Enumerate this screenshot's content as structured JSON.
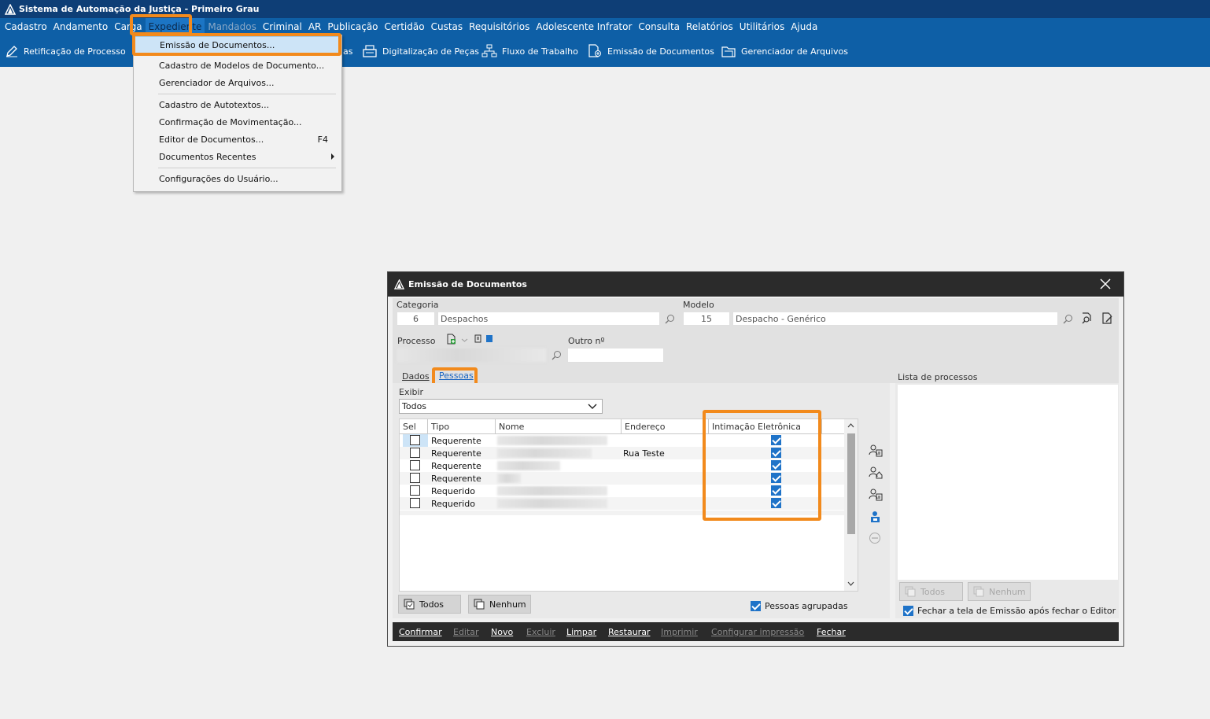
{
  "app": {
    "title": "Sistema de Automação da Justiça - Primeiro Grau"
  },
  "menu": [
    {
      "label": "Cadastro"
    },
    {
      "label": "Andamento"
    },
    {
      "label": "Carga"
    },
    {
      "label": "Expediente"
    },
    {
      "label": "Mandados"
    },
    {
      "label": "Criminal"
    },
    {
      "label": "AR"
    },
    {
      "label": "Publicação"
    },
    {
      "label": "Certidão"
    },
    {
      "label": "Custas"
    },
    {
      "label": "Requisitórios"
    },
    {
      "label": "Adolescente Infrator"
    },
    {
      "label": "Consulta"
    },
    {
      "label": "Relatórios"
    },
    {
      "label": "Utilitários"
    },
    {
      "label": "Ajuda"
    }
  ],
  "toolbar": {
    "retificacao": "Retificação de Processo",
    "partial": "as",
    "digitalizacao": "Digitalização de Peças",
    "fluxo": "Fluxo de Trabalho",
    "emissao": "Emissão de Documentos",
    "gerenciador": "Gerenciador de Arquivos"
  },
  "dropdown": {
    "items": [
      {
        "label": "Emissão de Documentos..."
      },
      {
        "label": "Cadastro de Modelos de Documento..."
      },
      {
        "label": "Gerenciador de Arquivos..."
      },
      {
        "label": "Cadastro de Autotextos..."
      },
      {
        "label": "Confirmação de Movimentação..."
      },
      {
        "label": "Editor de Documentos...",
        "shortcut": "F4"
      },
      {
        "label": "Documentos Recentes"
      },
      {
        "label": "Configurações do Usuário..."
      }
    ]
  },
  "dialog": {
    "title": "Emissão de Documentos",
    "categoria": {
      "label": "Categoria",
      "code": "6",
      "name": "Despachos"
    },
    "modelo": {
      "label": "Modelo",
      "code": "15",
      "name": "Despacho - Genérico"
    },
    "processo": {
      "label": "Processo"
    },
    "outro": {
      "label": "Outro nº",
      "value": ""
    },
    "tabs": {
      "dados": "Dados",
      "pessoas": "Pessoas"
    },
    "exibir": {
      "label": "Exibir",
      "value": "Todos"
    },
    "grid": {
      "headers": {
        "sel": "Sel",
        "tipo": "Tipo",
        "nome": "Nome",
        "endereco": "Endereço",
        "intimacao": "Intimação Eletrônica"
      },
      "rows": [
        {
          "tipo": "Requerente",
          "endereco": "",
          "intimacao": true
        },
        {
          "tipo": "Requerente",
          "endereco": "Rua Teste",
          "intimacao": true
        },
        {
          "tipo": "Requerente",
          "endereco": "",
          "intimacao": true
        },
        {
          "tipo": "Requerente",
          "endereco": "",
          "intimacao": true
        },
        {
          "tipo": "Requerido",
          "endereco": "",
          "intimacao": true
        },
        {
          "tipo": "Requerido",
          "endereco": "",
          "intimacao": true
        }
      ]
    },
    "buttons": {
      "todos": "Todos",
      "nenhum": "Nenhum"
    },
    "pessoas_agrupadas": "Pessoas agrupadas",
    "lista": {
      "label": "Lista de processos",
      "todos": "Todos",
      "nenhum": "Nenhum",
      "fechar_label": "Fechar a tela de Emissão após fechar o Editor"
    },
    "actions": {
      "confirmar": "Confirmar",
      "editar": "Editar",
      "novo": "Novo",
      "excluir": "Excluir",
      "limpar": "Limpar",
      "restaurar": "Restaurar",
      "imprimir": "Imprimir",
      "configurar": "Configurar impressão",
      "fechar": "Fechar"
    }
  },
  "colors": {
    "accent": "#f28a1c",
    "menubar": "#0e5fa6",
    "titlebar": "#0e3e76",
    "check": "#1f73c8"
  }
}
